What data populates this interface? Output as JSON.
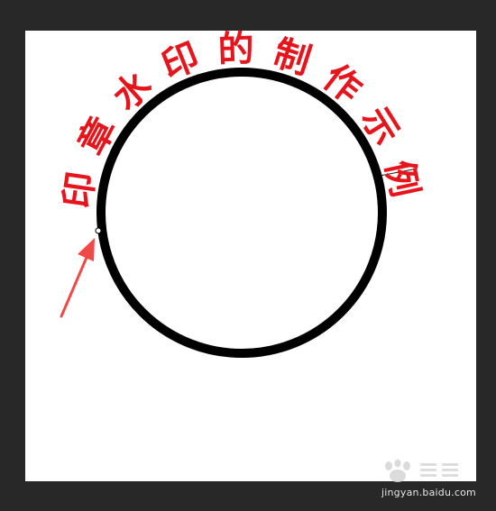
{
  "artwork": {
    "arc_text": "印章水印的制作示例",
    "text_color": "#e8141c",
    "circle_color": "#000000",
    "arrow_color": "#f04a48",
    "canvas_color": "#ffffff",
    "workspace_color": "#282828"
  },
  "watermark": {
    "url": "jingyan.baidu.com",
    "logo_icon": "baidu-jingyan-logo-icon"
  }
}
